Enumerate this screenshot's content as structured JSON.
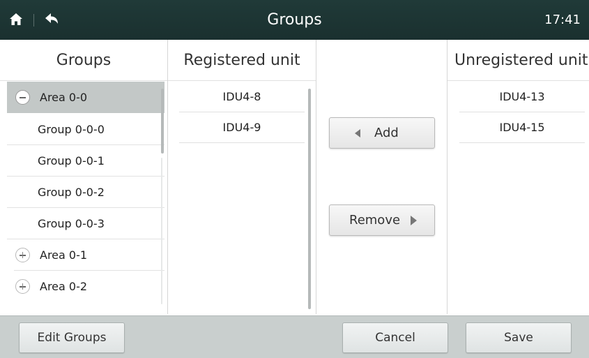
{
  "header": {
    "title": "Groups",
    "time": "17:41",
    "home_icon": "home-icon",
    "back_icon": "back-arrow-icon"
  },
  "columns": {
    "groups": "Groups",
    "registered": "Registered unit",
    "unregistered": "Unregistered unit"
  },
  "tree": [
    {
      "label": "Area 0-0",
      "type": "area",
      "expanded": true,
      "selected": true
    },
    {
      "label": "Group 0-0-0",
      "type": "group"
    },
    {
      "label": "Group 0-0-1",
      "type": "group"
    },
    {
      "label": "Group 0-0-2",
      "type": "group"
    },
    {
      "label": "Group 0-0-3",
      "type": "group"
    },
    {
      "label": "Area 0-1",
      "type": "area",
      "expanded": false
    },
    {
      "label": "Area 0-2",
      "type": "area",
      "expanded": false
    }
  ],
  "registered_units": [
    "IDU4-8",
    "IDU4-9"
  ],
  "unregistered_units": [
    "IDU4-13",
    "IDU4-15"
  ],
  "actions": {
    "add": "Add",
    "remove": "Remove"
  },
  "footer": {
    "edit_groups": "Edit Groups",
    "cancel": "Cancel",
    "save": "Save"
  },
  "colors": {
    "header_bg": "#1c3432",
    "footer_bg": "#c9cfce",
    "selected_row": "#c3c8c7"
  }
}
